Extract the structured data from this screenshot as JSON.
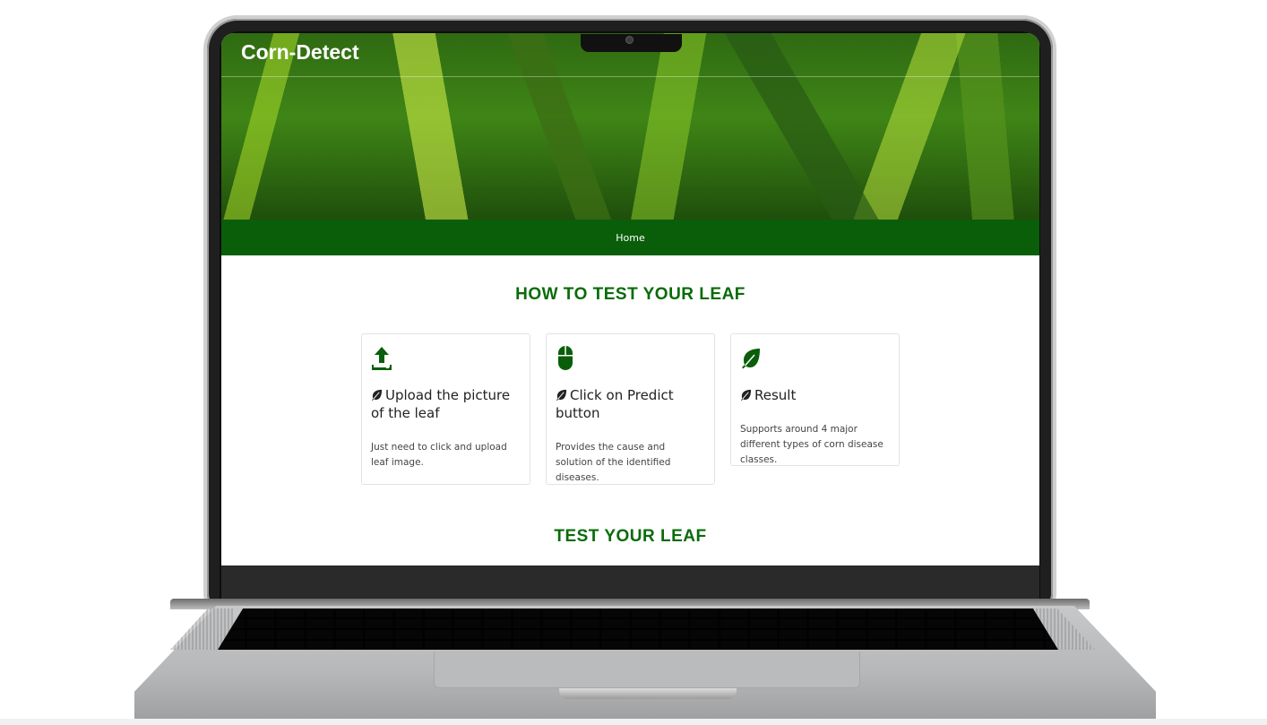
{
  "site": {
    "brand": "Corn-Detect",
    "nav": {
      "home": "Home"
    }
  },
  "how_to": {
    "title": "HOW TO TEST YOUR LEAF",
    "cards": [
      {
        "icon": "upload-icon",
        "title": "Upload the picture of the leaf",
        "text": "Just need to click and upload leaf image."
      },
      {
        "icon": "mouse-icon",
        "title": "Click on Predict button",
        "text": "Provides the cause and solution of the identified diseases."
      },
      {
        "icon": "leaf-icon",
        "title": "Result",
        "text": "Supports around 4 major different types of corn disease classes."
      }
    ]
  },
  "test": {
    "title": "TEST YOUR LEAF"
  },
  "colors": {
    "primary_green": "#0a5e0a",
    "heading_green": "#0a6b0a"
  }
}
